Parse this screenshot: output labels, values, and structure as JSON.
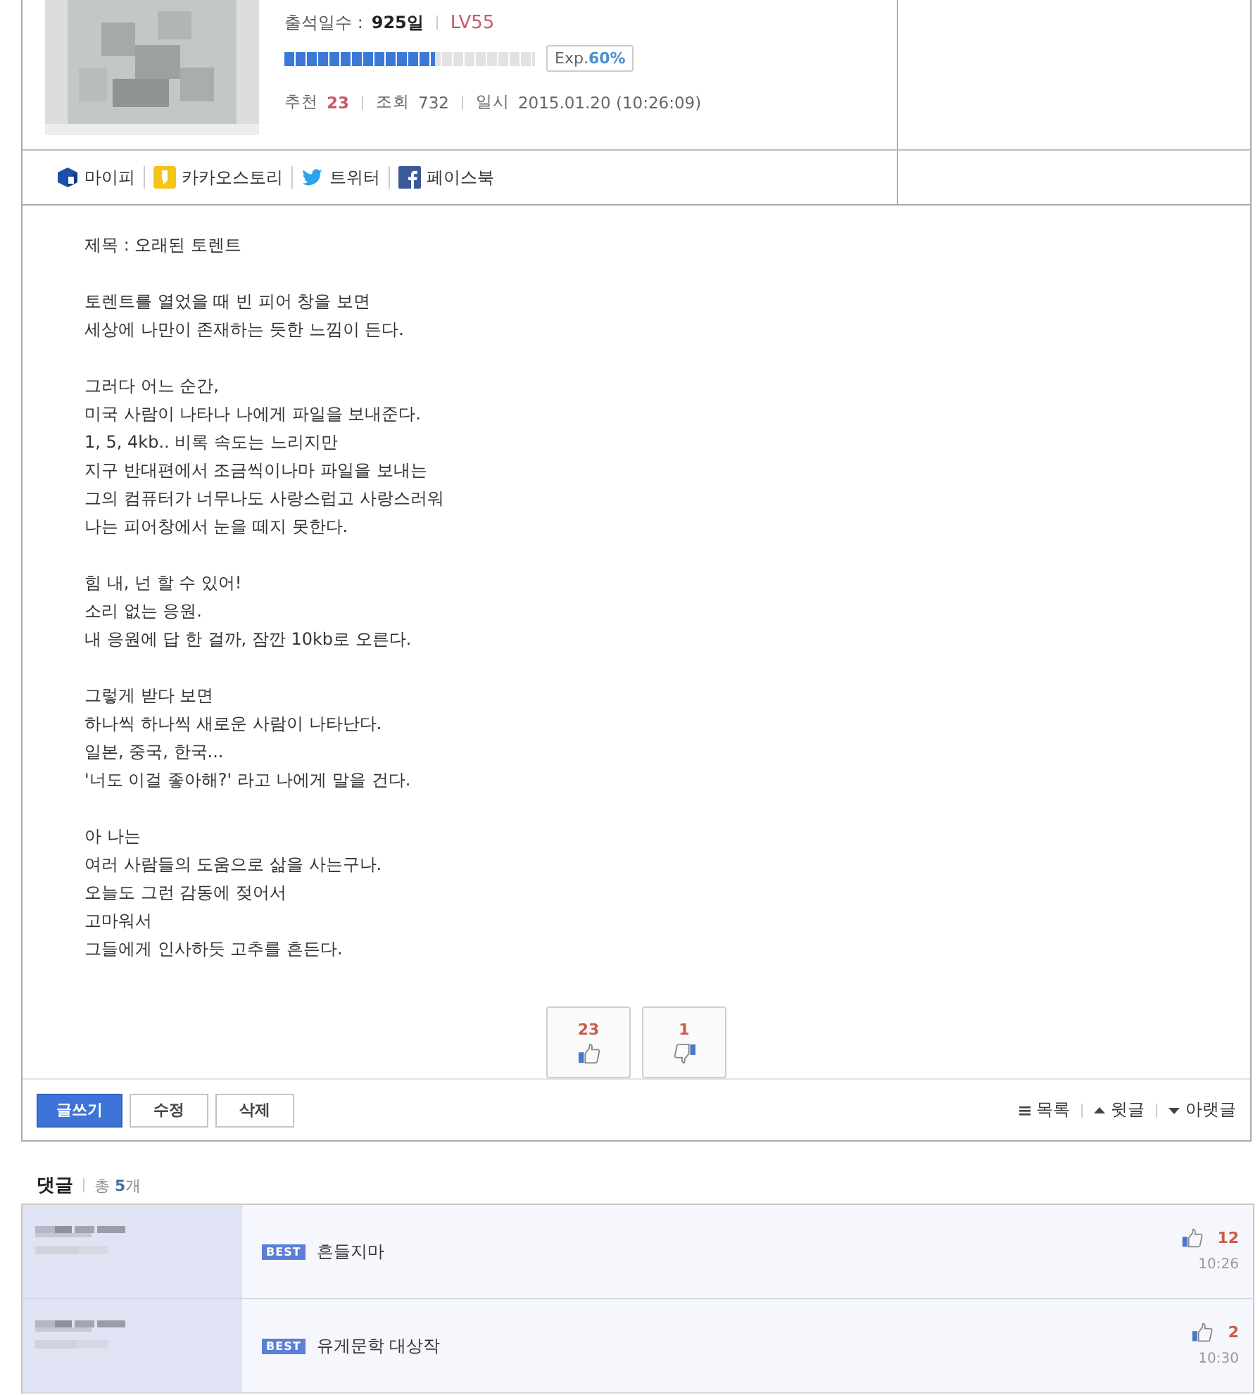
{
  "profile": {
    "attendance_label": "출석일수 :",
    "attendance_value": "925일",
    "level_badge": "LV55",
    "exp": {
      "label": "Exp.",
      "value": "60%",
      "level": 0.6
    },
    "stats": [
      {
        "label": "추천",
        "value": "23",
        "kind": "highlight"
      },
      {
        "label": "조회",
        "value": "732",
        "kind": "plain"
      },
      {
        "label": "일시",
        "value": "2015.01.20 (10:26:09)",
        "kind": "plain"
      }
    ]
  },
  "share": [
    {
      "label": "마이피",
      "kind": "mypi"
    },
    {
      "label": "카카오스토리",
      "kind": "kakao"
    },
    {
      "label": "트위터",
      "kind": "twitter"
    },
    {
      "label": "페이스북",
      "kind": "facebook"
    }
  ],
  "post": {
    "title": "제목 : 오래된 토렌트",
    "paragraphs": [
      [
        "토렌트를 열었을 때 빈 피어 창을 보면",
        "세상에 나만이 존재하는 듯한 느낌이 든다."
      ],
      [
        "그러다 어느 순간,",
        "미국 사람이 나타나 나에게 파일을 보내준다.",
        "1, 5, 4kb.. 비록 속도는 느리지만",
        "지구 반대편에서 조금씩이나마 파일을 보내는",
        "그의 컴퓨터가 너무나도 사랑스럽고 사랑스러워",
        "나는 피어창에서 눈을 떼지 못한다."
      ],
      [
        "힘 내, 넌 할 수 있어!",
        "소리 없는 응원.",
        "내 응원에 답 한 걸까, 잠깐 10kb로 오른다."
      ],
      [
        "그렇게 받다 보면",
        "하나씩 하나씩 새로운 사람이 나타난다.",
        "일본, 중국, 한국...",
        "'너도 이걸 좋아해?' 라고 나에게 말을 건다."
      ],
      [
        "아 나는",
        "여러 사람들의 도움으로 삶을 사는구나.",
        "오늘도 그런 감동에 젖어서",
        "고마워서",
        "그들에게 인사하듯 고추를 흔든다."
      ]
    ]
  },
  "votes": [
    {
      "kind": "up",
      "count": "23"
    },
    {
      "kind": "down",
      "count": "1"
    }
  ],
  "actions": [
    {
      "label": "글쓰기",
      "kind": "primary"
    },
    {
      "label": "수정",
      "kind": "plain"
    },
    {
      "label": "삭제",
      "kind": "plain"
    }
  ],
  "nav": [
    {
      "label": "목록",
      "kind": "list"
    },
    {
      "label": "윗글",
      "kind": "up"
    },
    {
      "label": "아랫글",
      "kind": "down"
    }
  ],
  "comments": {
    "heading": "댓글",
    "total_label": "총",
    "total_count": "5",
    "total_unit": "개",
    "items": [
      {
        "badge": "BEST",
        "text": "흔들지마",
        "likes": "12",
        "time": "10:26"
      },
      {
        "badge": "BEST",
        "text": "유게문학 대상작",
        "likes": "2",
        "time": "10:30"
      }
    ]
  }
}
